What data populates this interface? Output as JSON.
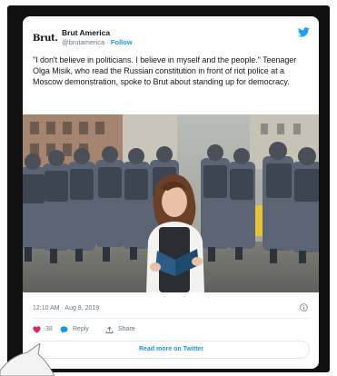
{
  "account": {
    "logo": "Brut.",
    "name": "Brut America",
    "handle": "@brutamerica",
    "separator": "·",
    "follow": "Follow"
  },
  "tweet": {
    "text": "\"I don't believe in politicians. I believe in myself and the people.\" Teenager Olga Misik, who read the Russian constitution in front of riot police at a Moscow demonstration, spoke to Brut about standing up for democracy."
  },
  "meta": {
    "timestamp": "12:10 AM · Aug 9, 2019"
  },
  "actions": {
    "likes": "38",
    "reply": "Reply",
    "share": "Share"
  },
  "read_more": "Read more on Twitter",
  "icons": [
    "twitter-bird-icon",
    "info-icon",
    "heart-icon",
    "reply-bubble-icon",
    "share-icon"
  ],
  "colors": {
    "link": "#1b95e0",
    "like": "#e0245e",
    "text": "#14171a",
    "muted": "#657786",
    "frame": "#101010"
  }
}
